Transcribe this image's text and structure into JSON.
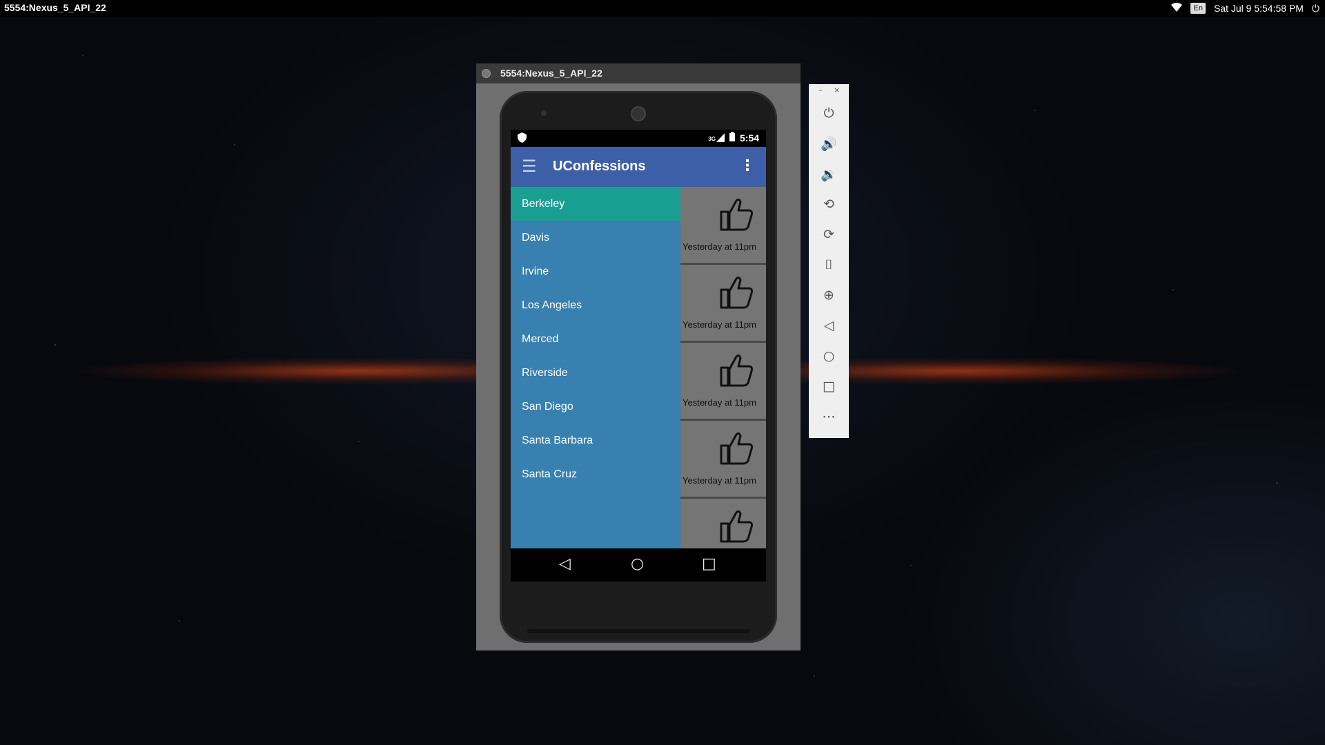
{
  "topbar": {
    "window_title": "5554:Nexus_5_API_22",
    "keyboard": "En",
    "datetime": "Sat Jul  9  5:54:58 PM"
  },
  "emulator": {
    "title": "5554:Nexus_5_API_22"
  },
  "phone": {
    "status_time": "5:54",
    "network": "3G",
    "app_title": "UConfessions",
    "drawer_items": [
      {
        "label": "Berkeley",
        "active": true
      },
      {
        "label": "Davis",
        "active": false
      },
      {
        "label": "Irvine",
        "active": false
      },
      {
        "label": "Los Angeles",
        "active": false
      },
      {
        "label": "Merced",
        "active": false
      },
      {
        "label": "Riverside",
        "active": false
      },
      {
        "label": "San Diego",
        "active": false
      },
      {
        "label": "Santa Barbara",
        "active": false
      },
      {
        "label": "Santa Cruz",
        "active": false
      }
    ],
    "feed_cards": [
      {
        "time": "Yesterday at 11pm"
      },
      {
        "time": "Yesterday at 11pm"
      },
      {
        "time": "Yesterday at 11pm"
      },
      {
        "time": "Yesterday at 11pm"
      },
      {
        "time": ""
      }
    ]
  },
  "colors": {
    "app_bar": "#3d5fa7",
    "drawer": "#3780b0",
    "drawer_active": "#199e92"
  },
  "panel_buttons": [
    "power-icon",
    "volume-up-icon",
    "volume-down-icon",
    "rotate-left-icon",
    "rotate-right-icon",
    "camera-icon",
    "zoom-icon",
    "back-icon",
    "home-icon",
    "overview-icon",
    "more-icon"
  ]
}
